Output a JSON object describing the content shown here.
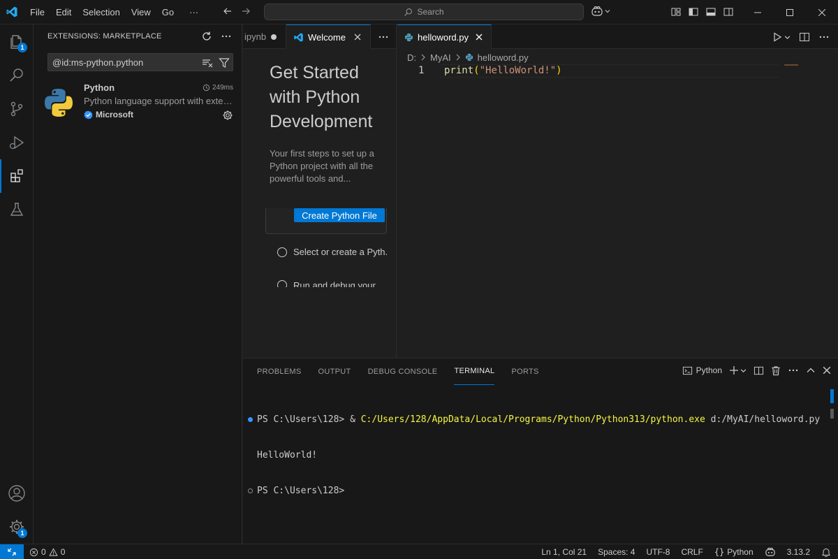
{
  "titlebar": {
    "menu": [
      "File",
      "Edit",
      "Selection",
      "View",
      "Go",
      "···"
    ],
    "search_placeholder": "Search"
  },
  "activity": {
    "explorer_badge": "1",
    "settings_badge": "1"
  },
  "sidebar": {
    "title": "EXTENSIONS: MARKETPLACE",
    "search_value": "@id:ms-python.python",
    "extension": {
      "name": "Python",
      "time": "249ms",
      "description": "Python language support with extensions for access points, debugging, and more",
      "publisher": "Microsoft"
    }
  },
  "editor_left": {
    "tab_partial": "ipynb",
    "tab_welcome": "Welcome",
    "title": "Get Started with Python Development",
    "description": "Your first steps to set up a Python project with all the powerful tools and...",
    "create_button": "Create Python File",
    "steps": [
      "Select or create a Pyth.",
      "Run and debug your"
    ]
  },
  "editor_right": {
    "tab_file": "helloword.py",
    "breadcrumb": [
      "D:",
      "MyAI",
      "helloword.py"
    ],
    "line_number": "1",
    "code_fn": "print",
    "code_open": "(",
    "code_str": "\"HelloWorld!\"",
    "code_close": ")"
  },
  "panel": {
    "tabs": [
      "PROBLEMS",
      "OUTPUT",
      "DEBUG CONSOLE",
      "TERMINAL",
      "PORTS"
    ],
    "active_tab": "TERMINAL",
    "terminal_name": "Python",
    "lines": {
      "prompt1": "PS C:\\Users\\128> ",
      "amp": "& ",
      "exe": "C:/Users/128/AppData/Local/Programs/Python/Python313/python.exe",
      "arg": " d:/MyAI/helloword.py",
      "output": "HelloWorld!",
      "prompt2": "PS C:\\Users\\128>"
    }
  },
  "statusbar": {
    "errors": "0",
    "warnings": "0",
    "position": "Ln 1, Col 21",
    "spaces": "Spaces: 4",
    "encoding": "UTF-8",
    "eol": "CRLF",
    "language": "Python",
    "version": "3.13.2"
  },
  "colors": {
    "accent": "#0078d4",
    "code_fn": "#dcdcaa",
    "code_str": "#ce9178",
    "code_paren": "#ffd700",
    "terminal_path": "#f5f543"
  }
}
